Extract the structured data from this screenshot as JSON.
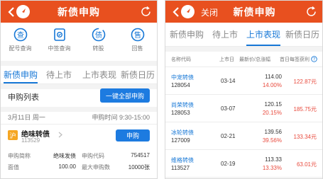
{
  "left": {
    "title": "新债申购",
    "quick_actions": [
      {
        "label": "配号查询",
        "icon": "chevron-badge-icon"
      },
      {
        "label": "中签查询",
        "icon": "document-check-icon"
      },
      {
        "label": "转股",
        "icon": "bond-icon"
      },
      {
        "label": "回售",
        "icon": "sell-icon"
      }
    ],
    "icon_glyphs": [
      "查",
      "签",
      "债",
      "售"
    ],
    "tabs": [
      "新债申购",
      "待上市",
      "上市表现",
      "新债日历"
    ],
    "active_tab": 0,
    "list_title": "申购列表",
    "one_key_button": "一键全部申购",
    "date": "3月11日 周一",
    "time": "申购时间 9:30-15:00",
    "market_badge": "沪",
    "bond_name": "绝味转债",
    "bond_code": "113529",
    "apply_button": "申购",
    "details": [
      {
        "k1": "申购简称",
        "v1": "绝味发债",
        "k2": "申购代码",
        "v2": "754517"
      },
      {
        "k1": "面值",
        "v1": "100.00",
        "k2": "最大申购数",
        "v2": "10000张"
      }
    ]
  },
  "right": {
    "title": "新债申购",
    "close_label": "关闭",
    "tabs": [
      "新债申购",
      "待上市",
      "上市表现",
      "新债日历"
    ],
    "active_tab": 2,
    "columns": [
      "名称代码",
      "上市日",
      "最新价/总涨幅",
      "首日每签获利"
    ],
    "rows": [
      {
        "name": "中宠转债",
        "code": "128054",
        "date": "03-14",
        "price": "114.00",
        "pct": "14.00%",
        "profit": "122.87元"
      },
      {
        "name": "尚荣转债",
        "code": "128053",
        "date": "03-07",
        "price": "120.15",
        "pct": "20.15%",
        "profit": "185.75元"
      },
      {
        "name": "冰轮转债",
        "code": "127009",
        "date": "02-21",
        "price": "139.56",
        "pct": "39.56%",
        "profit": "133.34元"
      },
      {
        "name": "维格转债",
        "code": "113527",
        "date": "02-19",
        "price": "113.33",
        "pct": "13.33%",
        "profit": "63.01元"
      }
    ]
  },
  "colors": {
    "brand": "#e8501f",
    "accent": "#1677d6",
    "up": "#e84a3d"
  }
}
